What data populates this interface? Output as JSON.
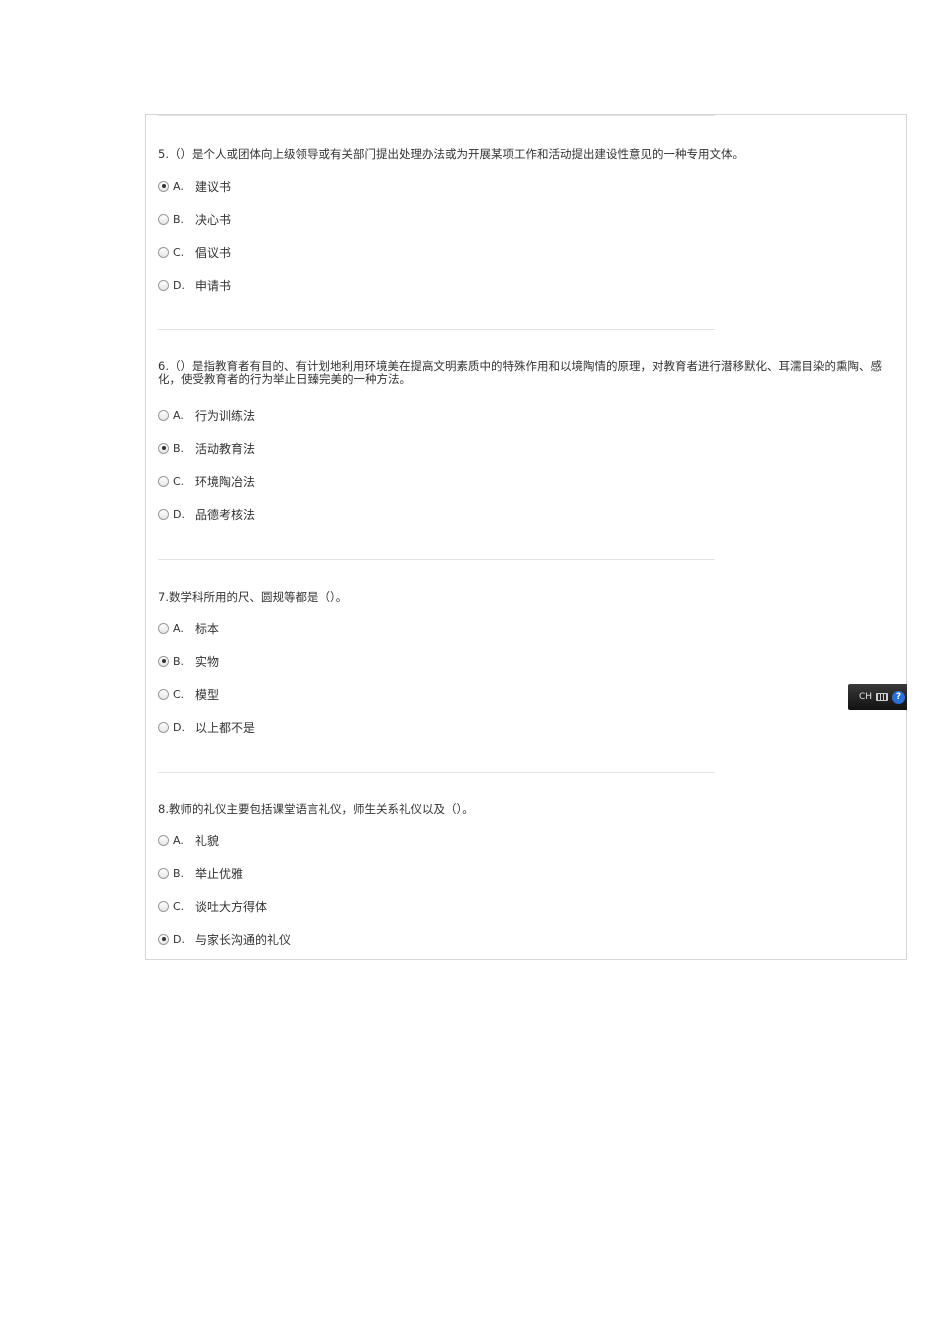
{
  "questions": [
    {
      "text": "5.（）是个人或团体向上级领导或有关部门提出处理办法或为开展某项工作和活动提出建设性意见的一种专用文体。",
      "options": [
        {
          "letter": "A.",
          "text": "建议书",
          "checked": true
        },
        {
          "letter": "B.",
          "text": "决心书",
          "checked": false
        },
        {
          "letter": "C.",
          "text": "倡议书",
          "checked": false
        },
        {
          "letter": "D.",
          "text": "申请书",
          "checked": false
        }
      ]
    },
    {
      "text": "6.（）是指教育者有目的、有计划地利用环境美在提高文明素质中的特殊作用和以境陶情的原理，对教育者进行潜移默化、耳濡目染的熏陶、感化，使受教育者的行为举止日臻完美的一种方法。",
      "options": [
        {
          "letter": "A.",
          "text": "行为训练法",
          "checked": false
        },
        {
          "letter": "B.",
          "text": "活动教育法",
          "checked": true
        },
        {
          "letter": "C.",
          "text": "环境陶冶法",
          "checked": false
        },
        {
          "letter": "D.",
          "text": "品德考核法",
          "checked": false
        }
      ]
    },
    {
      "text": "7.数学科所用的尺、圆规等都是（）。",
      "options": [
        {
          "letter": "A.",
          "text": "标本",
          "checked": false
        },
        {
          "letter": "B.",
          "text": "实物",
          "checked": true
        },
        {
          "letter": "C.",
          "text": "模型",
          "checked": false
        },
        {
          "letter": "D.",
          "text": "以上都不是",
          "checked": false
        }
      ]
    },
    {
      "text": "8.教师的礼仪主要包括课堂语言礼仪，师生关系礼仪以及（）。",
      "options": [
        {
          "letter": "A.",
          "text": "礼貌",
          "checked": false
        },
        {
          "letter": "B.",
          "text": "举止优雅",
          "checked": false
        },
        {
          "letter": "C.",
          "text": "谈吐大方得体",
          "checked": false
        },
        {
          "letter": "D.",
          "text": "与家长沟通的礼仪",
          "checked": true
        }
      ]
    }
  ],
  "ime_bar": {
    "label": "CH",
    "help": "?"
  }
}
